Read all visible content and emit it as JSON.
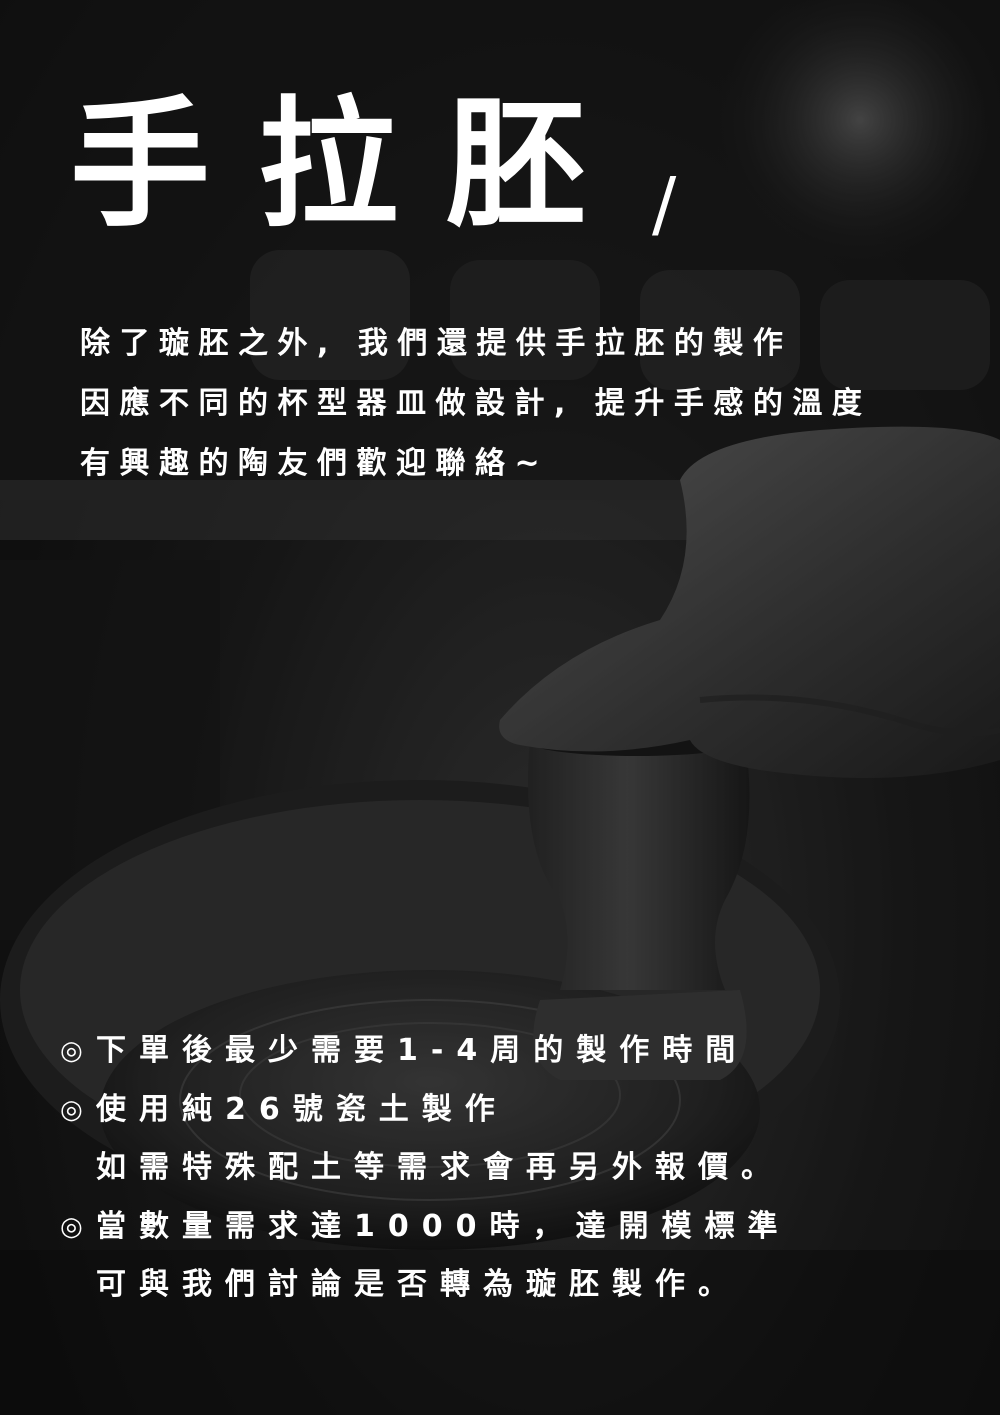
{
  "title": {
    "text": "手拉胚",
    "slash": "/"
  },
  "intro_lines": [
    "除了璇胚之外, 我們還提供手拉胚的製作",
    "因應不同的杯型器皿做設計, 提升手感的溫度",
    "有興趣的陶友們歡迎聯絡~"
  ],
  "bullet_symbol": "◎",
  "notes": [
    {
      "bullet": true,
      "text": "下單後最少需要1-4周的製作時間"
    },
    {
      "bullet": true,
      "text": "使用純26號瓷土製作"
    },
    {
      "bullet": false,
      "text": "如需特殊配土等需求會再另外報價。"
    },
    {
      "bullet": true,
      "text": "當數量需求達1000時，達開模標準"
    },
    {
      "bullet": false,
      "text": "可與我們討論是否轉為璇胚製作。"
    }
  ],
  "background": {
    "description_icon": "pottery-wheel-photo",
    "tone": "#2a2a2a"
  }
}
